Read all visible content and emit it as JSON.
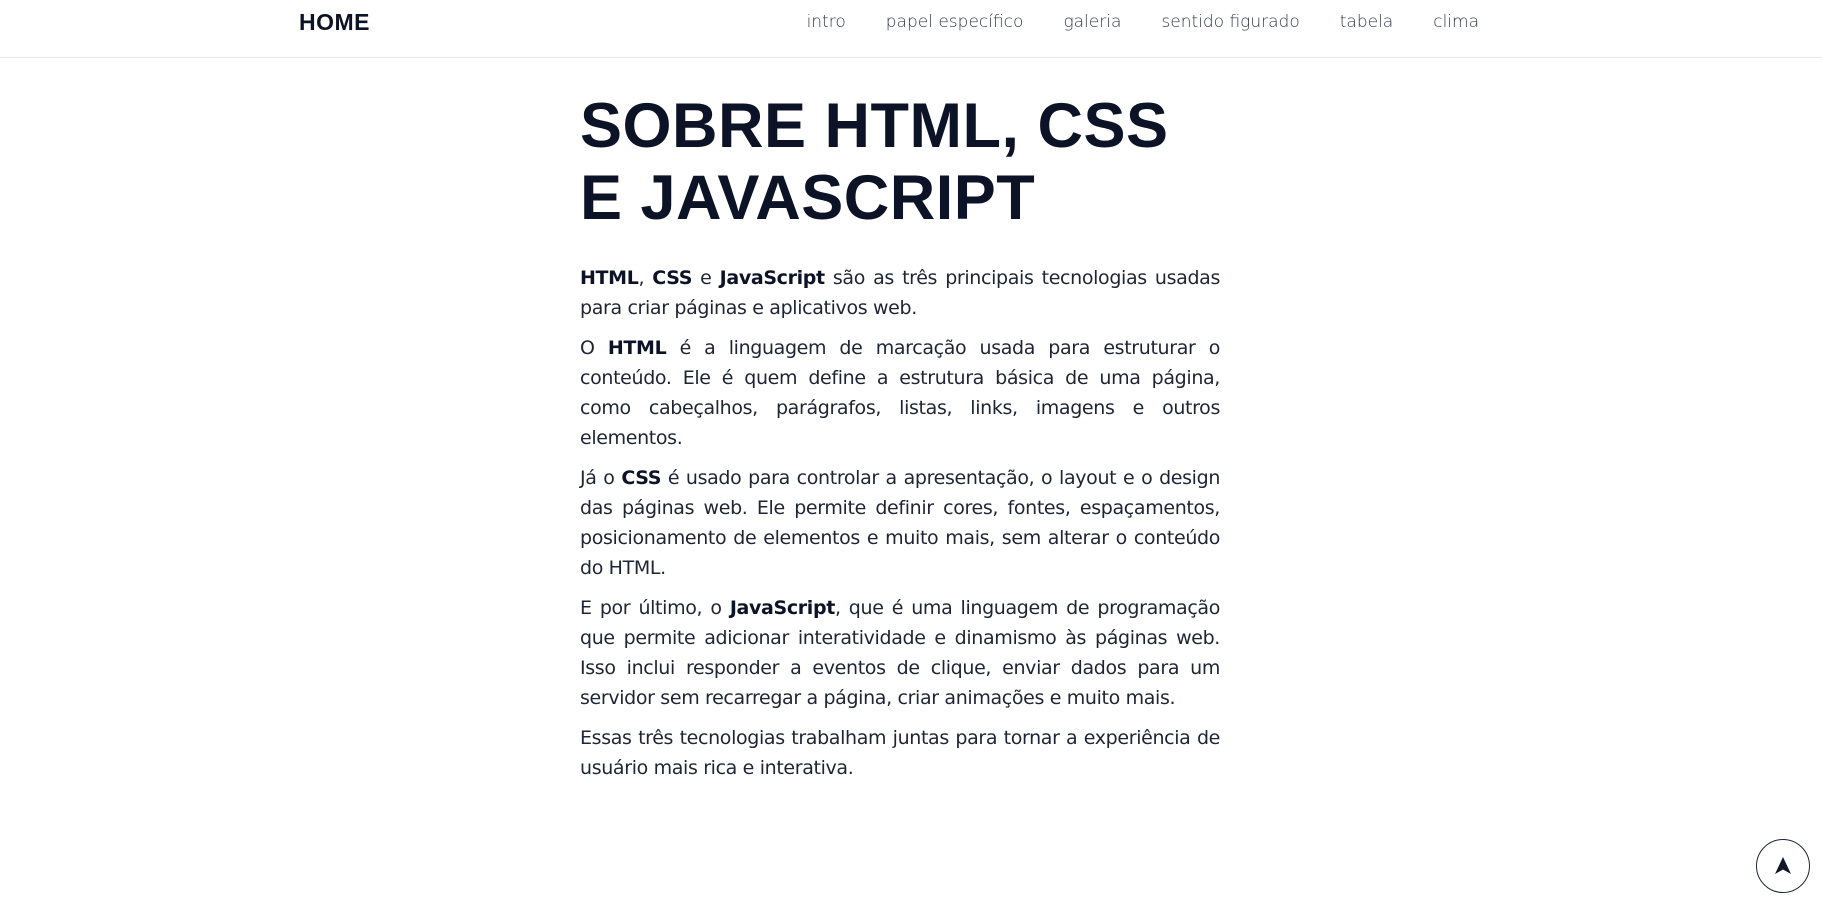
{
  "header": {
    "brand": "HOME",
    "nav": [
      "intro",
      "papel específico",
      "galeria",
      "sentido figurado",
      "tabela",
      "clima"
    ]
  },
  "main": {
    "title": "SOBRE HTML, CSS E JAVASCRIPT",
    "p1": {
      "b1": "HTML",
      "t1": ", ",
      "b2": "CSS",
      "t2": " e ",
      "b3": "JavaScript",
      "t3": " são as três principais tecnologias usadas para criar páginas e aplicativos web."
    },
    "p2": {
      "t1": "O ",
      "b1": "HTML",
      "t2": " é a linguagem de marcação usada para estruturar o conteúdo. Ele é quem define a estrutura básica de uma página, como cabeçalhos, parágrafos, listas, links, imagens e outros elementos."
    },
    "p3": {
      "t1": "Já o ",
      "b1": "CSS",
      "t2": " é usado para controlar a apresentação, o layout e o design das páginas web. Ele permite definir cores, fontes, espaçamentos, posicionamento de elementos e muito mais, sem alterar o conteúdo do HTML."
    },
    "p4": {
      "t1": "E por último, o ",
      "b1": "JavaScript",
      "t2": ", que é uma linguagem de programação que permite adicionar interatividade e dinamismo às páginas web. Isso inclui responder a eventos de clique, enviar dados para um servidor sem recarregar a página, criar animações e muito mais."
    },
    "p5": {
      "t1": "Essas três tecnologias trabalham juntas para tornar a experiência de usuário mais rica e interativa."
    }
  },
  "scroll_top": {
    "icon": "arrow-up-icon"
  }
}
